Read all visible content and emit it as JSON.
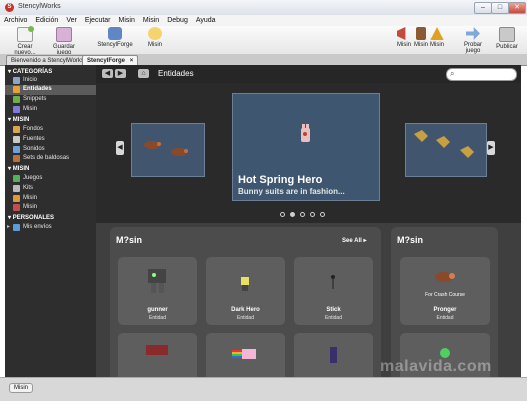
{
  "window": {
    "title": "StencylWorks",
    "app_icon_letter": "S",
    "minimize": "–",
    "maximize": "□",
    "close": "✕"
  },
  "menu": [
    "Archivo",
    "Edición",
    "Ver",
    "Ejecutar",
    "Misin",
    "Misin",
    "Debug",
    "Ayuda"
  ],
  "toolbar": {
    "left": [
      {
        "label": "Crear nuevo...",
        "icon": "new-file-icon",
        "color": "#76b84d"
      },
      {
        "label": "Guardar juego",
        "icon": "save-icon",
        "color": "#b784b7"
      },
      {
        "label": "StencylForge",
        "icon": "forge-icon",
        "color": "#5e87c4"
      },
      {
        "label": "Misin",
        "icon": "chat-icon",
        "color": "#f0c050"
      }
    ],
    "right": [
      {
        "label": "Misin",
        "icon": "megaphone-icon",
        "color": "#c44a3a"
      },
      {
        "label": "Misin",
        "icon": "book-icon",
        "color": "#8a5a34"
      },
      {
        "label": "Misin",
        "icon": "bell-icon",
        "color": "#e0a020"
      },
      {
        "label": "Probar juego",
        "icon": "play-arrow-icon",
        "color": "#7fa9d8"
      },
      {
        "label": "Publicar",
        "icon": "publish-icon",
        "color": "#9a9a9a"
      }
    ]
  },
  "tabs": [
    {
      "label": "Bienvenido a StencylWorks",
      "close": "×"
    },
    {
      "label": "StencylForge",
      "close": "×"
    }
  ],
  "sidebar": {
    "sections": [
      {
        "header": "CATEGORÍAS",
        "items": [
          {
            "label": "Inicio",
            "color": "#8fa3c8"
          },
          {
            "label": "Entidades",
            "color": "#e6a13b",
            "selected": true
          },
          {
            "label": "Snippets",
            "color": "#6ab04c"
          },
          {
            "label": "Misin",
            "color": "#7d7dd8"
          }
        ]
      },
      {
        "header": "MISIN",
        "items": [
          {
            "label": "Fondos",
            "color": "#d9a64f"
          },
          {
            "label": "Fuentes",
            "color": "#c9c9c9"
          },
          {
            "label": "Sonidos",
            "color": "#6fa0d9"
          },
          {
            "label": "Sets de baldosas",
            "color": "#c26e3a"
          }
        ]
      },
      {
        "header": "MISIN",
        "items": [
          {
            "label": "Juegos",
            "color": "#4fb35d"
          },
          {
            "label": "Kits",
            "color": "#bbbbbb"
          },
          {
            "label": "Misin",
            "color": "#d99b3b"
          },
          {
            "label": "Misin",
            "color": "#c05050"
          }
        ]
      },
      {
        "header": "PERSONALES",
        "items": [
          {
            "label": "Mis envíos",
            "color": "#5c9ad8",
            "expandable": true
          }
        ]
      }
    ]
  },
  "main": {
    "heading": "Entidades",
    "back": "◀",
    "forward": "▶",
    "home": "⌂",
    "search_icon": "⌕",
    "featured": {
      "title": "Hot Spring Hero",
      "subtitle": "Bunny suits are in fashion...",
      "active_dot": 1,
      "dot_count": 5
    },
    "carousel_prev": "◀",
    "carousel_next": "▶",
    "panels": [
      {
        "title": "M?sin",
        "see_all": "See All",
        "cards": [
          {
            "name": "gunner",
            "kind": "Entidad",
            "art": "robot"
          },
          {
            "name": "Dark Hero",
            "kind": "Entidad",
            "art": "hero"
          },
          {
            "name": "Stick",
            "kind": "Entidad",
            "art": "stick"
          },
          {
            "name": "",
            "kind": "",
            "art": "red"
          },
          {
            "name": "",
            "kind": "",
            "art": "rainbow"
          },
          {
            "name": "",
            "kind": "",
            "art": "ninja"
          }
        ]
      },
      {
        "title": "M?sin",
        "cards": [
          {
            "name": "Pronger",
            "kind": "Entidad",
            "sub": "For Crash Course",
            "art": "boar"
          },
          {
            "name": "",
            "kind": "",
            "art": "bubble"
          }
        ]
      }
    ]
  },
  "status": {
    "button": "Misin"
  },
  "watermark": "malavida.com",
  "colors": {
    "accent": "#41566e",
    "sidebar": "#2e2e2e",
    "main_bg": "#3f3f3f",
    "card": "#5e5e5e"
  }
}
